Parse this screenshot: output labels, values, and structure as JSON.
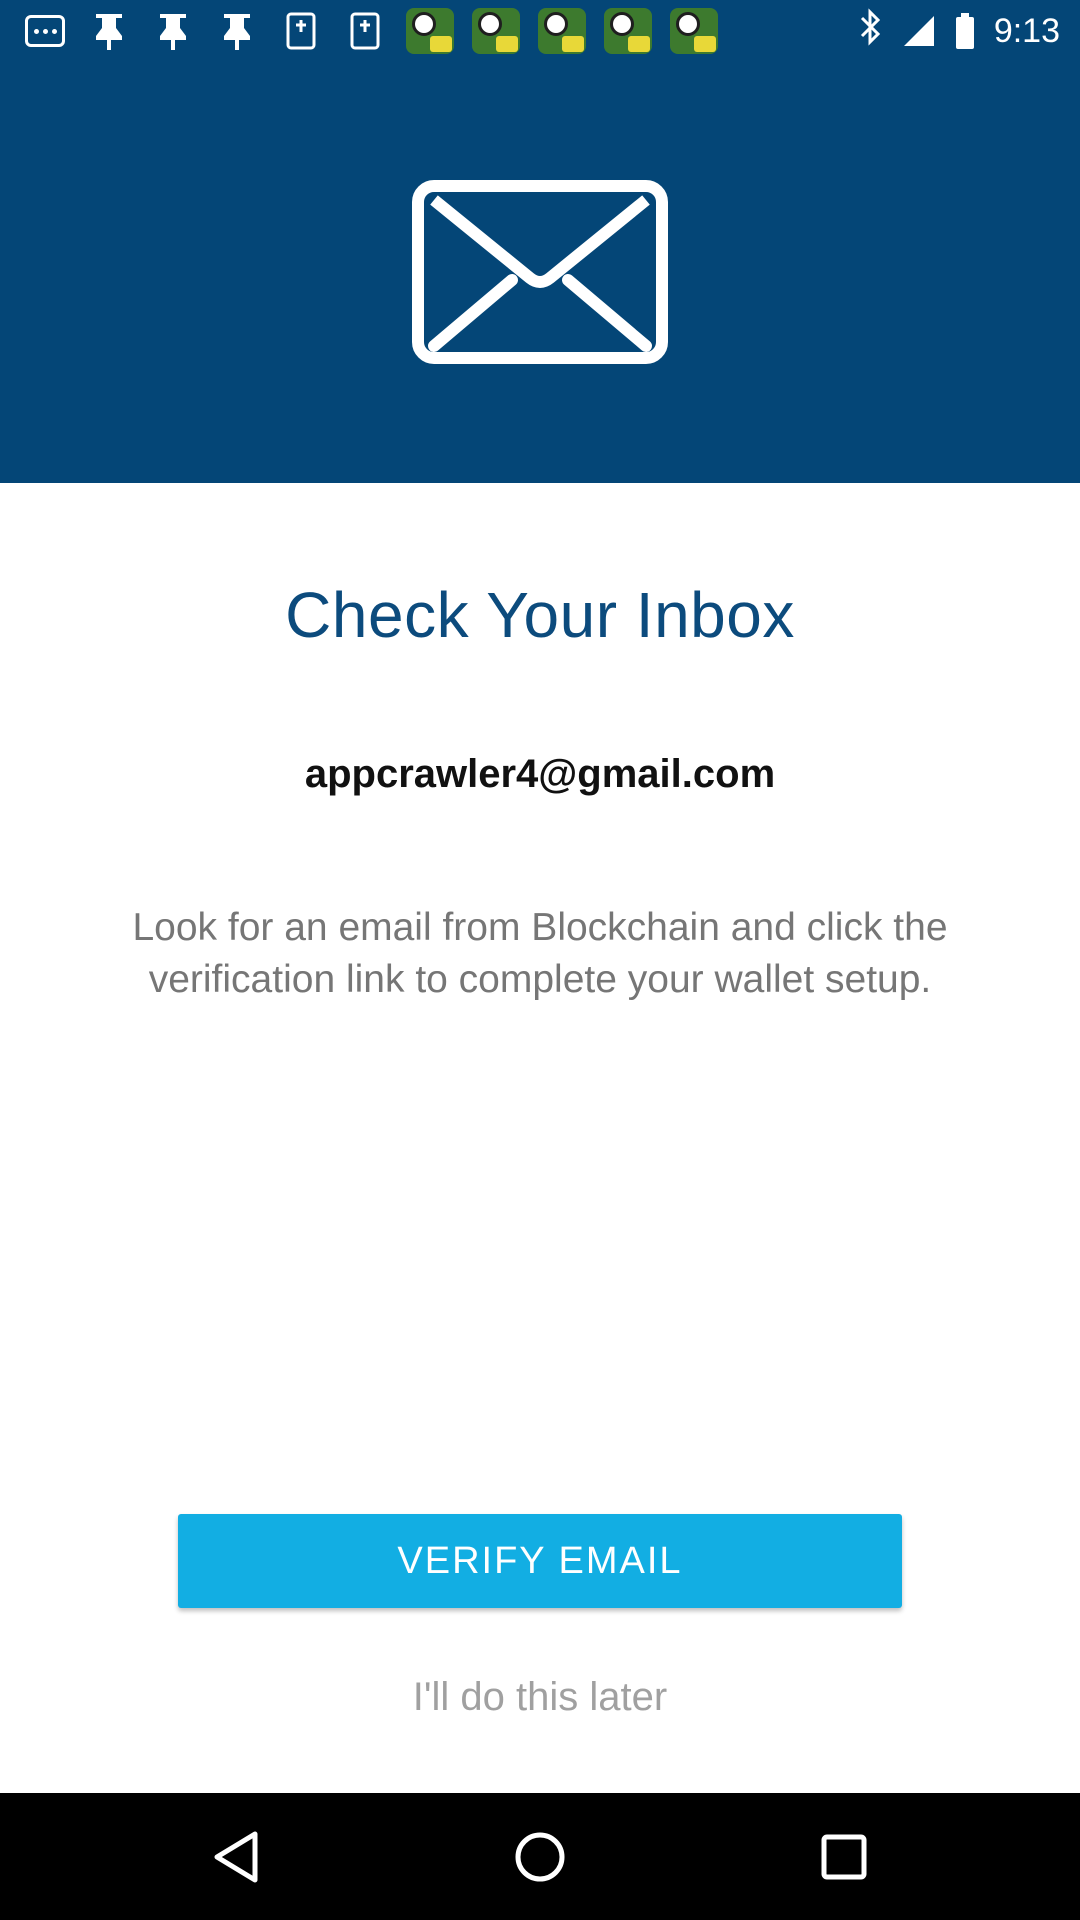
{
  "status_bar": {
    "time": "9:13",
    "notification_icons": [
      "dots-notification-icon",
      "pin-notification-icon",
      "pin-notification-icon",
      "pin-notification-icon",
      "dock-notification-icon",
      "dock-notification-icon",
      "app-notification-icon",
      "app-notification-icon",
      "app-notification-icon",
      "app-notification-icon",
      "app-notification-icon"
    ],
    "system_icons": [
      "bluetooth-icon",
      "signal-icon",
      "battery-icon"
    ]
  },
  "hero": {
    "icon": "mail-icon",
    "background_color": "#044677"
  },
  "content": {
    "title": "Check Your Inbox",
    "email": "appcrawler4@gmail.com",
    "description": "Look for an email from Blockchain and click the verification link to complete your wallet setup."
  },
  "actions": {
    "verify_label": "VERIFY EMAIL",
    "later_label": "I'll do this later",
    "verify_color": "#12aee3"
  },
  "nav_bar": {
    "buttons": [
      "back-icon",
      "home-icon",
      "recents-icon"
    ]
  }
}
